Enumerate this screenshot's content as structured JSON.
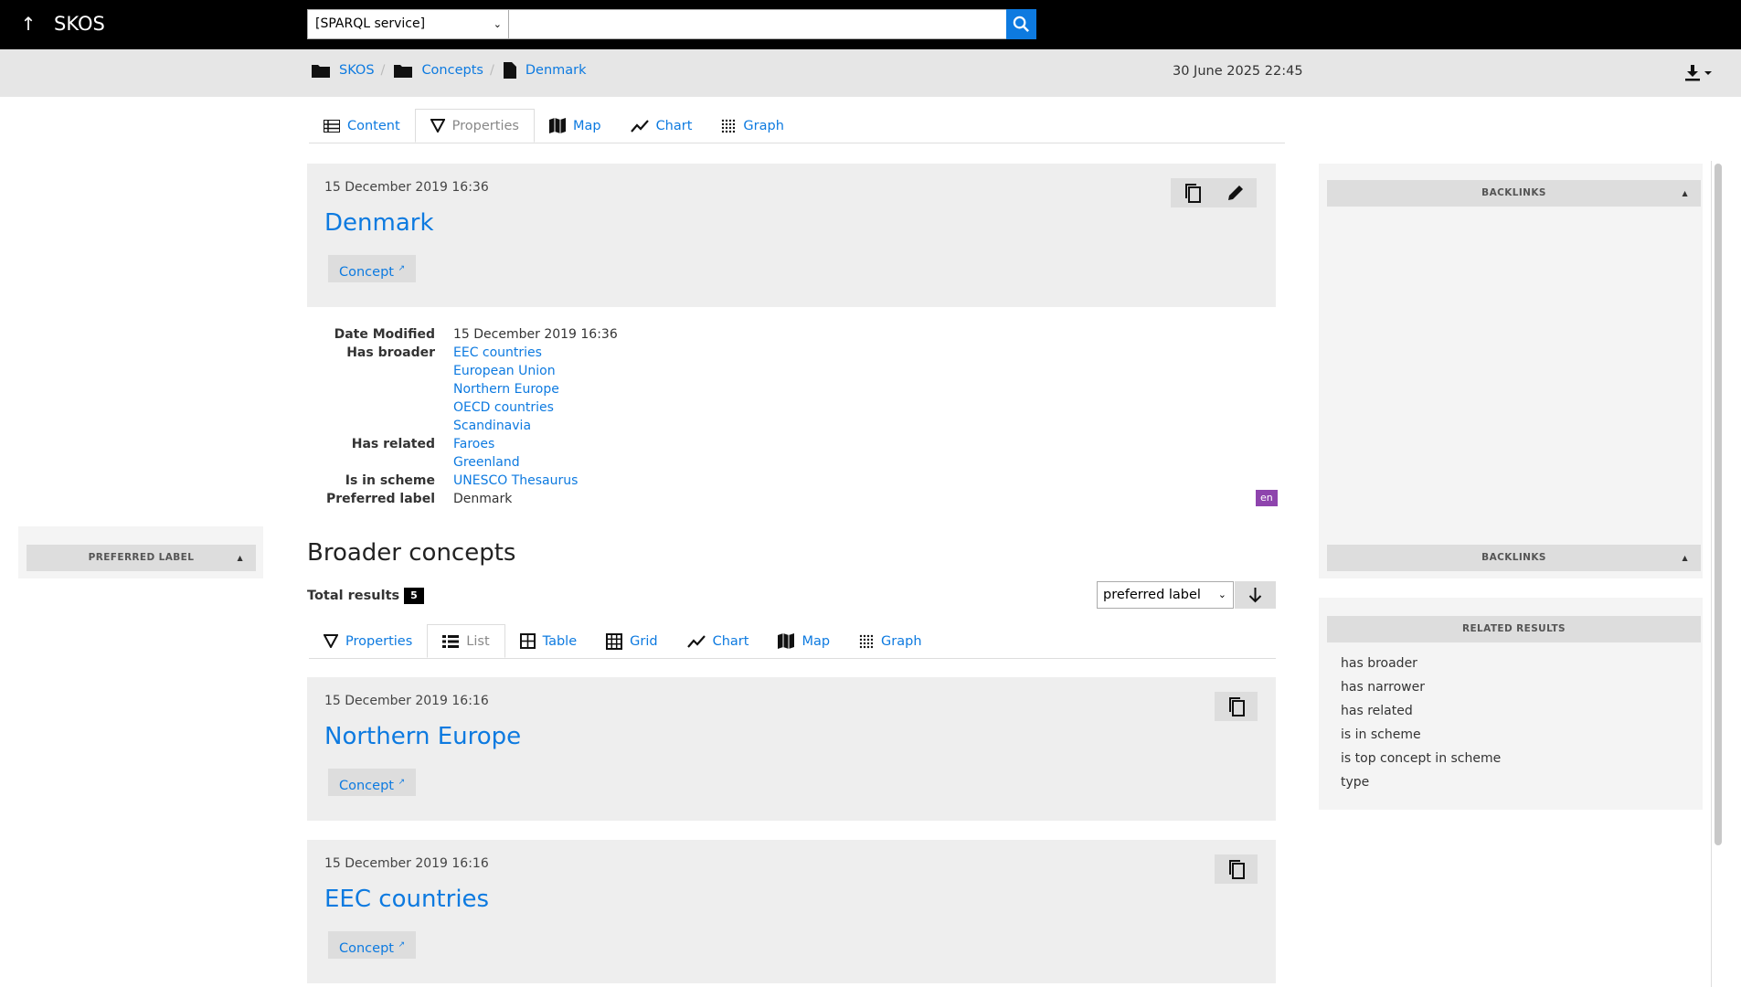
{
  "topbar": {
    "brand": "SKOS",
    "service_select": "[SPARQL service]",
    "search_value": ""
  },
  "breadcrumb": {
    "items": [
      "SKOS",
      "Concepts",
      "Denmark"
    ],
    "timestamp": "30 June 2025 22:45"
  },
  "mode_tabs": [
    "Content",
    "Properties",
    "Map",
    "Chart",
    "Graph"
  ],
  "resource": {
    "date": "15 December 2019 16:36",
    "title": "Denmark",
    "type": "Concept"
  },
  "properties": {
    "date_modified_label": "Date Modified",
    "date_modified_value": "15 December 2019 16:36",
    "has_broader_label": "Has broader",
    "has_broader_values": [
      "EEC countries",
      "European Union",
      "Northern Europe",
      "OECD countries",
      "Scandinavia"
    ],
    "has_related_label": "Has related",
    "has_related_values": [
      "Faroes",
      "Greenland"
    ],
    "is_in_scheme_label": "Is in scheme",
    "is_in_scheme_value": "UNESCO Thesaurus",
    "preferred_label_label": "Preferred label",
    "preferred_label_value": "Denmark",
    "lang": "en"
  },
  "left_panel": {
    "title": "PREFERRED LABEL"
  },
  "right_panels": {
    "backlinks_top": "BACKLINKS",
    "backlinks_bottom": "BACKLINKS",
    "related_results_title": "RELATED RESULTS",
    "related_results": [
      "has broader",
      "has narrower",
      "has related",
      "is in scheme",
      "is top concept in scheme",
      "type"
    ]
  },
  "broader": {
    "title": "Broader concepts",
    "total_label": "Total results",
    "total_count": "5",
    "sort_select": "preferred label",
    "view_tabs": [
      "Properties",
      "List",
      "Table",
      "Grid",
      "Chart",
      "Map",
      "Graph"
    ],
    "items": [
      {
        "date": "15 December 2019 16:16",
        "title": "Northern Europe",
        "type": "Concept"
      },
      {
        "date": "15 December 2019 16:16",
        "title": "EEC countries",
        "type": "Concept"
      }
    ]
  },
  "colors": {
    "accent": "#0d7ae0",
    "topbar": "#000000",
    "badge": "#8e44ad"
  }
}
